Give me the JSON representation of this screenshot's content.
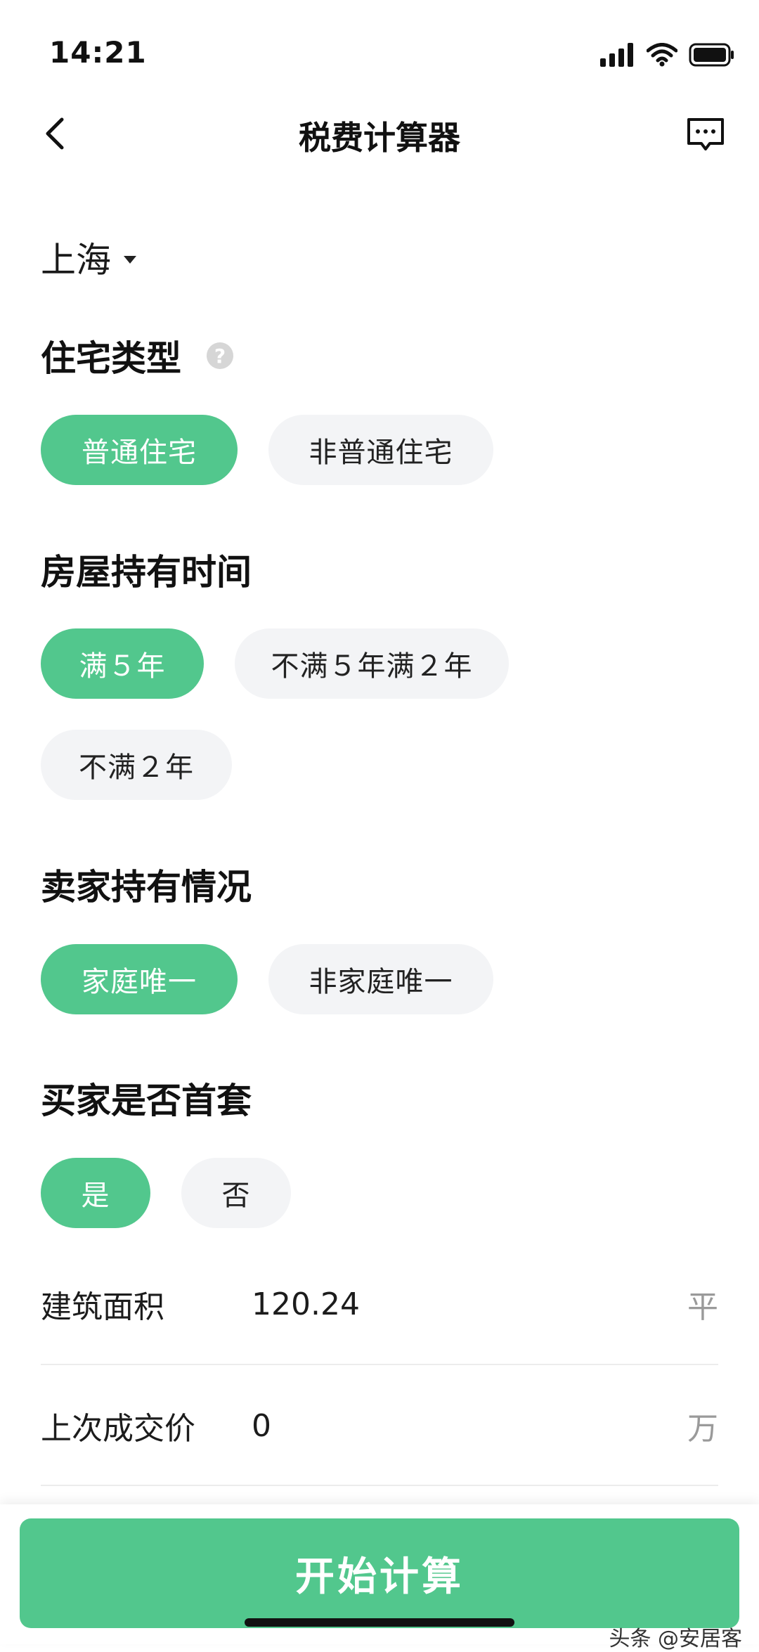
{
  "status_bar": {
    "time": "14:21"
  },
  "nav": {
    "title": "税费计算器"
  },
  "city": {
    "label": "上海"
  },
  "housing_type": {
    "title": "住宅类型",
    "help_glyph": "?",
    "options": [
      {
        "label": "普通住宅",
        "selected": true
      },
      {
        "label": "非普通住宅",
        "selected": false
      }
    ]
  },
  "holding_period": {
    "title": "房屋持有时间",
    "options": [
      {
        "label": "满５年",
        "selected": true
      },
      {
        "label": "不满５年满２年",
        "selected": false
      },
      {
        "label": "不满２年",
        "selected": false
      }
    ]
  },
  "seller_status": {
    "title": "卖家持有情况",
    "options": [
      {
        "label": "家庭唯一",
        "selected": true
      },
      {
        "label": "非家庭唯一",
        "selected": false
      }
    ]
  },
  "buyer_first_home": {
    "title": "买家是否首套",
    "options": [
      {
        "label": "是",
        "selected": true
      },
      {
        "label": "否",
        "selected": false
      }
    ]
  },
  "form": {
    "area": {
      "label": "建筑面积",
      "value": "120.24",
      "unit": "平"
    },
    "last_price": {
      "label": "上次成交价",
      "value": "0",
      "unit": "万"
    }
  },
  "actions": {
    "calculate_label": "开始计算"
  },
  "watermark": "头条 @安居客",
  "colors": {
    "accent": "#52c78d",
    "chip_inactive": "#f3f4f6",
    "unit_gray": "#9a9a9a"
  },
  "icons": [
    "signal-icon",
    "wifi-icon",
    "battery-icon",
    "back-arrow-icon",
    "feedback-icon",
    "dropdown-caret-icon",
    "help-icon"
  ]
}
